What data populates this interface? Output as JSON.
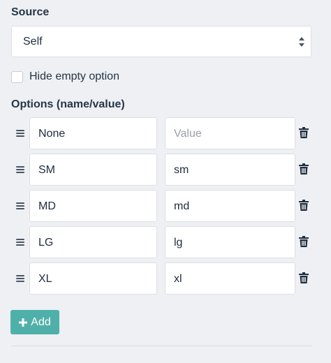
{
  "source": {
    "label": "Source",
    "selected": "Self"
  },
  "hide_empty": {
    "label": "Hide empty option",
    "checked": false
  },
  "options": {
    "label": "Options (name/value)",
    "rows": [
      {
        "name": "None",
        "value": "",
        "value_placeholder": "Value"
      },
      {
        "name": "SM",
        "value": "sm"
      },
      {
        "name": "MD",
        "value": "md"
      },
      {
        "name": "LG",
        "value": "lg"
      },
      {
        "name": "XL",
        "value": "xl"
      }
    ]
  },
  "add_button": {
    "label": "Add",
    "icon": "plus-icon"
  },
  "icons": {
    "drag": "drag-handle-icon",
    "delete": "trash-icon",
    "select": "sort-arrows-icon"
  },
  "colors": {
    "background": "#eef0f4",
    "accent": "#4fb0a9",
    "text": "#263645",
    "placeholder": "#9aa0a8"
  }
}
